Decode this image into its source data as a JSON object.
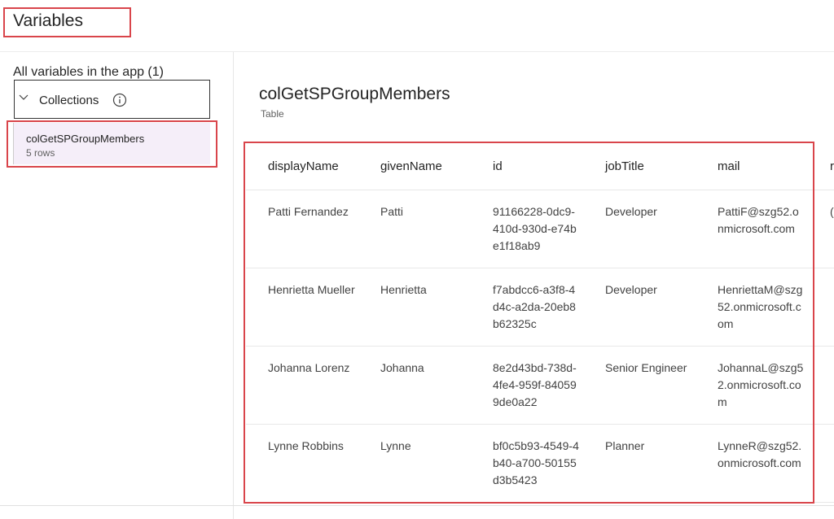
{
  "header": {
    "title": "Variables"
  },
  "sidebar": {
    "heading": "All variables in the app (1)",
    "group": {
      "label": "Collections",
      "expand_icon": "chevron-down-icon",
      "info_icon": "info-icon"
    },
    "items": [
      {
        "name": "colGetSPGroupMembers",
        "rows": "5 rows"
      }
    ]
  },
  "main": {
    "title": "colGetSPGroupMembers",
    "subtitle": "Table",
    "table": {
      "columns": [
        "displayName",
        "givenName",
        "id",
        "jobTitle",
        "mail",
        "r"
      ],
      "rows": [
        [
          "Patti Fernandez",
          "Patti",
          "91166228-0dc9-410d-930d-e74be1f18ab9",
          "Developer",
          "PattiF@szg52.onmicrosoft.com",
          "("
        ],
        [
          "Henrietta Mueller",
          "Henrietta",
          "f7abdcc6-a3f8-4d4c-a2da-20eb8b62325c",
          "Developer",
          "HenriettaM@szg52.onmicrosoft.com",
          ""
        ],
        [
          "Johanna Lorenz",
          "Johanna",
          "8e2d43bd-738d-4fe4-959f-840599de0a22",
          "Senior Engineer",
          "JohannaL@szg52.onmicrosoft.com",
          ""
        ],
        [
          "Lynne Robbins",
          "Lynne",
          "bf0c5b93-4549-4b40-a700-50155d3b5423",
          "Planner",
          "LynneR@szg52.onmicrosoft.com",
          ""
        ]
      ]
    }
  },
  "colors": {
    "highlight": "#d9454b",
    "selected_bg": "#f5eef9"
  }
}
